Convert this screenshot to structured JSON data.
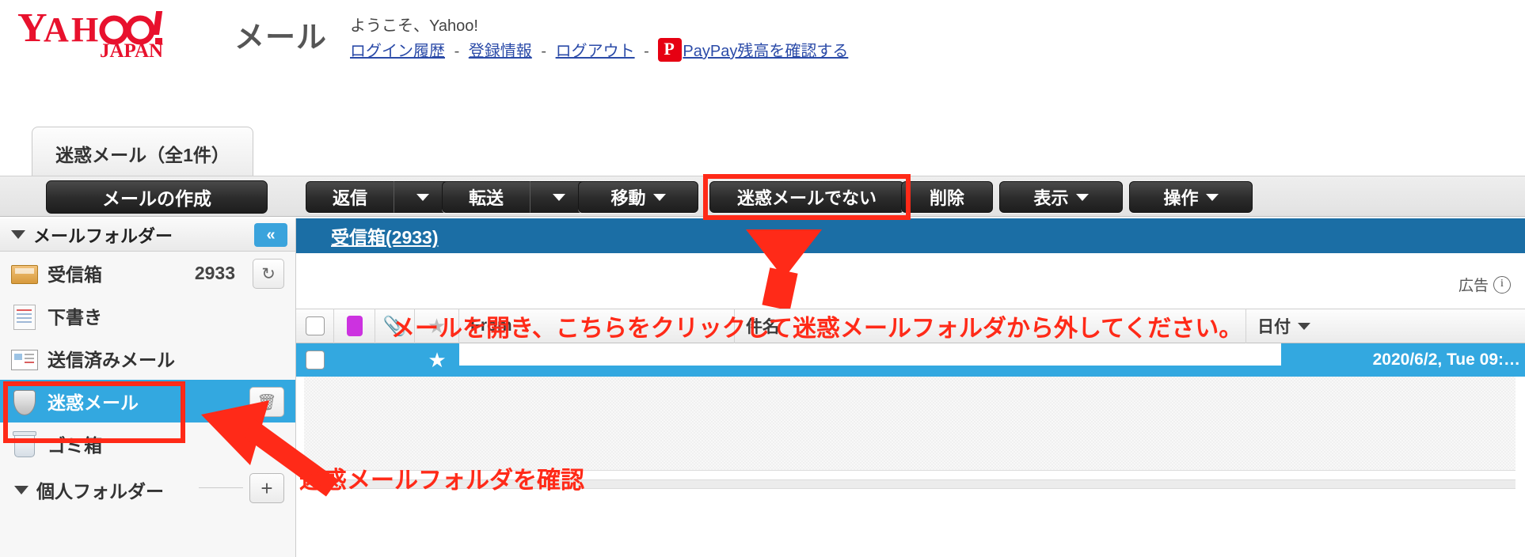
{
  "header": {
    "logo_main": "YAHOO!",
    "logo_sub": "JAPAN",
    "service": "メール",
    "welcome": "ようこそ、Yahoo!",
    "links": [
      {
        "label": "ログイン履歴"
      },
      {
        "label": "登録情報"
      },
      {
        "label": "ログアウト"
      },
      {
        "label": "PayPay残高を確認する"
      }
    ],
    "separator": "-"
  },
  "tab": {
    "label": "迷惑メール（全1件）"
  },
  "compose": {
    "label": "メールの作成"
  },
  "toolbar": {
    "reply": "返信",
    "forward": "転送",
    "move": "移動",
    "not_spam": "迷惑メールでない",
    "delete": "削除",
    "display": "表示",
    "action": "操作"
  },
  "sidebar": {
    "header_label": "メールフォルダー",
    "collapse_label": "«",
    "refresh_icon": "↻",
    "trash_icon": "🗑",
    "plus_icon": "+",
    "items": [
      {
        "label": "受信箱",
        "count": "2933",
        "icon": "inbox-icon"
      },
      {
        "label": "下書き",
        "count": "",
        "icon": "draft-icon"
      },
      {
        "label": "送信済みメール",
        "count": "",
        "icon": "sent-icon"
      },
      {
        "label": "迷惑メール",
        "count": "",
        "icon": "shield-icon"
      },
      {
        "label": "ゴミ箱",
        "count": "",
        "icon": "trash-icon"
      }
    ],
    "personal_folder_label": "個人フォルダー"
  },
  "main": {
    "inbox_link": "受信箱(2933)",
    "ad_label": "広告",
    "ad_info_icon": "i",
    "columns": {
      "from": "From",
      "subject": "件名",
      "date": "日付"
    },
    "rows": [
      {
        "date": "2020/6/2, Tue 09:…",
        "from": "",
        "subject": ""
      }
    ]
  },
  "annotations": {
    "top": "メールを開き、こちらをクリックして迷惑メールフォルダから外してください。",
    "bottom": "迷惑メールフォルダを確認"
  },
  "colors": {
    "brand_red": "#e60012",
    "link_blue": "#2b4ba8",
    "selection_blue": "#33a8e0",
    "header_bar_blue": "#1b6ea5",
    "annotation_red": "#ff2a18"
  }
}
